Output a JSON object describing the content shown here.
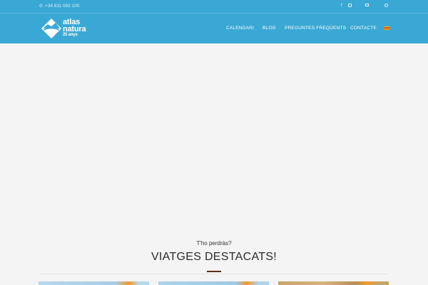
{
  "topbar": {
    "phone": "+34 611 092 100",
    "icons": [
      "facebook-icon",
      "instagram-icon",
      "cart-icon",
      "search-icon"
    ]
  },
  "logo": {
    "line1": "atlas",
    "line2": "natura",
    "line3": "25 anys"
  },
  "nav": {
    "items": [
      {
        "label": "CALENDARI"
      },
      {
        "label": "BLOG"
      },
      {
        "label": "PREGUNTES FREQÜENTS"
      },
      {
        "label": "CONTACTE"
      }
    ],
    "language_flag": "catalan-flag-icon"
  },
  "featured": {
    "kicker": "T'ho perdràs?",
    "title": "VIATGES DESTACATS!"
  },
  "colors": {
    "header": "#3aa8d4",
    "accent": "#f39a2a",
    "underline": "#5a2f1c"
  }
}
